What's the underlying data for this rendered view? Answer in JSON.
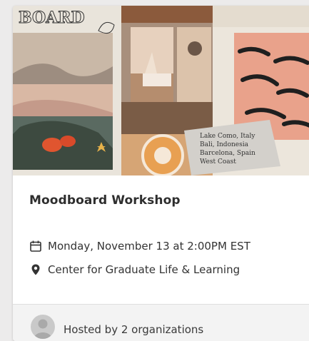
{
  "event": {
    "banner_text": "BOARD",
    "title": "Moodboard Workshop",
    "date": "Monday, November 13 at 2:00PM EST",
    "location": "Center for Graduate Life & Learning",
    "host_text": "Hosted by 2 organizations"
  },
  "icons": {
    "date": "calendar-icon",
    "location": "map-pin-icon",
    "host": "avatar-icon"
  },
  "colors": {
    "title": "#2e2e2e",
    "text": "#333333",
    "footer_bg": "#f3f3f3",
    "page_bg": "#ecebeb"
  }
}
